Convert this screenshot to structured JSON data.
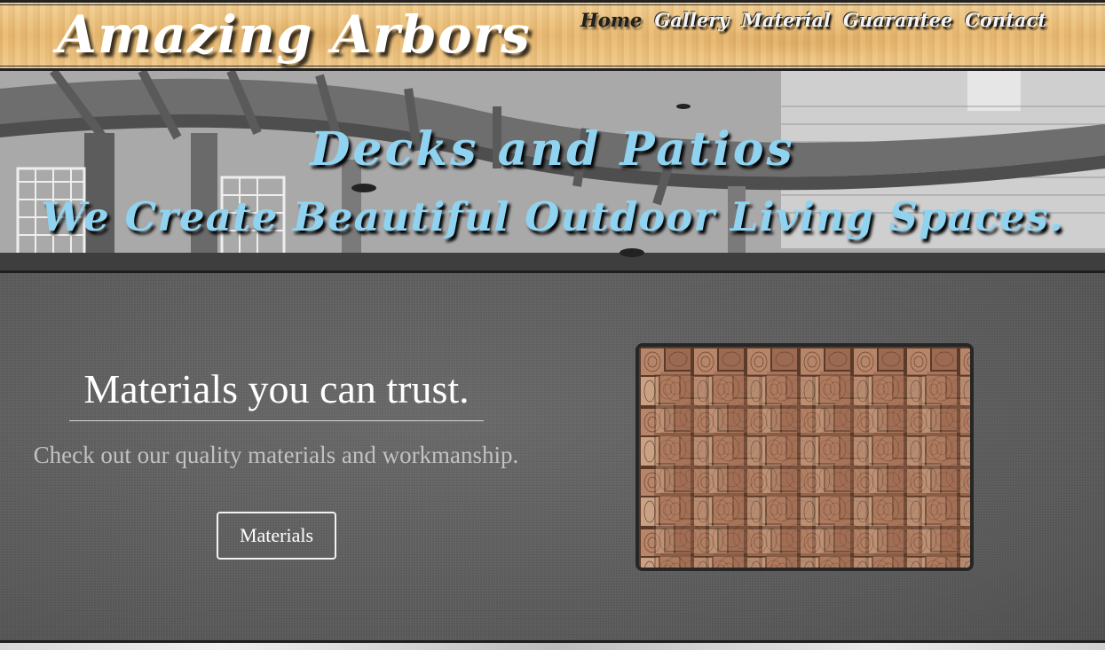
{
  "site": {
    "logo": "Amazing Arbors"
  },
  "nav": {
    "items": [
      {
        "label": "Home",
        "active": true
      },
      {
        "label": "Gallery",
        "active": false
      },
      {
        "label": "Material",
        "active": false
      },
      {
        "label": "Guarantee",
        "active": false
      },
      {
        "label": "Contact",
        "active": false
      }
    ]
  },
  "hero": {
    "title": "Decks and Patios",
    "subtitle": "We Create Beautiful Outdoor Living Spaces."
  },
  "feature": {
    "heading": "Materials you can trust.",
    "text": "Check out our quality materials and workmanship.",
    "button_label": "Materials"
  },
  "colors": {
    "hero_text": "#8fd3f0",
    "wood_header": "#e8b971"
  }
}
